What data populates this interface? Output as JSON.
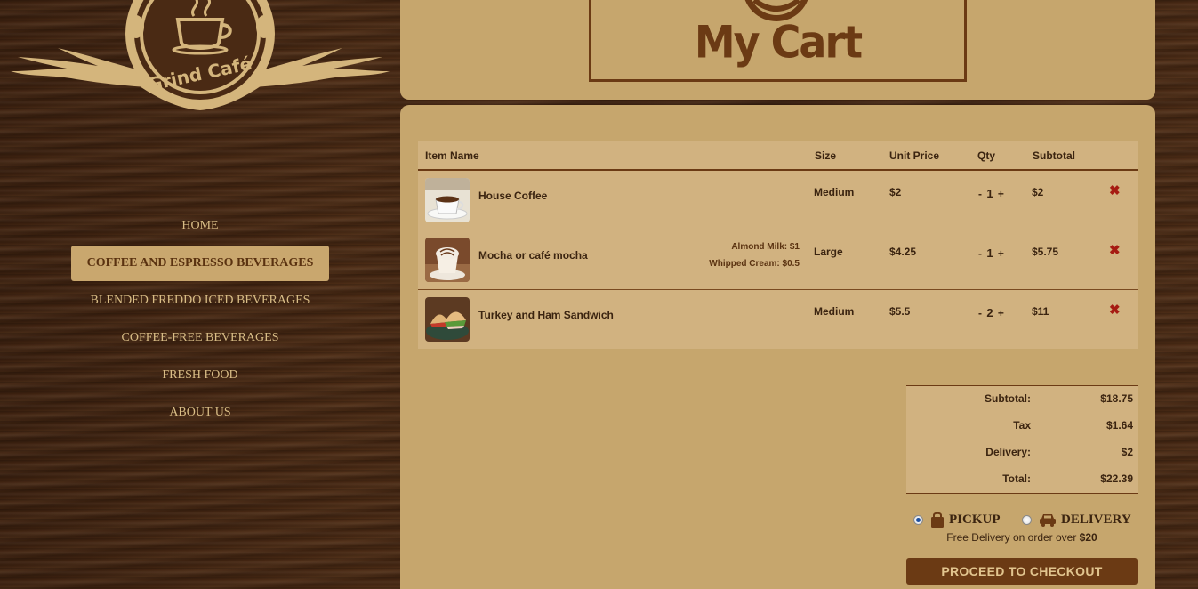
{
  "brand": {
    "name": "Grind Café"
  },
  "nav": {
    "items": [
      {
        "label": "HOME",
        "active": false
      },
      {
        "label": "COFFEE AND ESPRESSO BEVERAGES",
        "active": true
      },
      {
        "label": "BLENDED FREDDO ICED BEVERAGES",
        "active": false
      },
      {
        "label": "COFFEE-FREE BEVERAGES",
        "active": false
      },
      {
        "label": "FRESH FOOD",
        "active": false
      },
      {
        "label": "ABOUT US",
        "active": false
      }
    ]
  },
  "header": {
    "title": "My Cart"
  },
  "cart": {
    "columns": {
      "item": "Item Name",
      "size": "Size",
      "unit_price": "Unit Price",
      "qty": "Qty",
      "subtotal": "Subtotal"
    },
    "rows": [
      {
        "name": "House Coffee",
        "extras": [],
        "size": "Medium",
        "unit_price": "$2",
        "qty_minus": "-",
        "qty": "1",
        "qty_plus": "+",
        "subtotal": "$2",
        "remove": "✖"
      },
      {
        "name": "Mocha or café mocha",
        "extras": [
          "Almond Milk: $1",
          "Whipped Cream: $0.5"
        ],
        "size": "Large",
        "unit_price": "$4.25",
        "qty_minus": "-",
        "qty": "1",
        "qty_plus": "+",
        "subtotal": "$5.75",
        "remove": "✖"
      },
      {
        "name": "Turkey and Ham Sandwich",
        "extras": [],
        "size": "Medium",
        "unit_price": "$5.5",
        "qty_minus": "-",
        "qty": "2",
        "qty_plus": "+",
        "subtotal": "$11",
        "remove": "✖"
      }
    ]
  },
  "totals": {
    "subtotal_label": "Subtotal:",
    "subtotal": "$18.75",
    "tax_label": "Tax",
    "tax": "$1.64",
    "delivery_label": "Delivery:",
    "delivery": "$2",
    "total_label": "Total:",
    "total": "$22.39"
  },
  "fulfillment": {
    "pickup_label": "PICKUP",
    "delivery_label": "DELIVERY",
    "selected": "pickup",
    "free_note_prefix": "Free Delivery on order over ",
    "free_note_amount": "$20"
  },
  "checkout": {
    "label": "PROCEED TO CHECKOUT"
  },
  "colors": {
    "panel": "#c6a66d",
    "accent_brown": "#6b3a14",
    "remove_red": "#a61b12"
  }
}
